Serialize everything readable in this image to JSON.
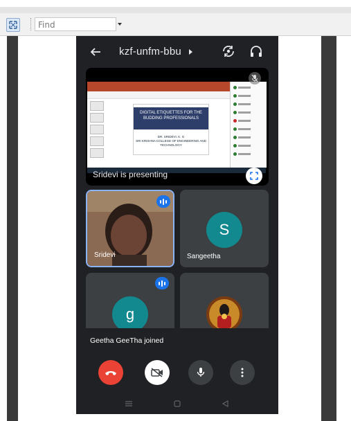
{
  "toolbar": {
    "find_placeholder": "Find",
    "expand_icon": "expand-icon"
  },
  "meeting": {
    "code": "kzf-unfm-bbu",
    "icons": {
      "back": "arrow-left-icon",
      "switch_camera": "camera-switch-icon",
      "audio": "headphones-icon"
    }
  },
  "presentation": {
    "label": "Sridevi is presenting",
    "slide_title": "DIGITAL ETIQUETTES FOR THE BUDDING PROFESSIONALS",
    "slide_author": "DR. SRIDEVI. K. G",
    "slide_college": "SRI KRISHNA COLLEGE OF ENGINEERING AND TECHNOLOGY"
  },
  "participants": [
    {
      "name": "Sridevi",
      "speaking": true,
      "type": "photo"
    },
    {
      "name": "Sangeetha",
      "speaking": false,
      "type": "letter",
      "initial": "S",
      "color": "#12888f"
    },
    {
      "name": "",
      "speaking": true,
      "type": "letter",
      "initial": "g",
      "color": "#12888f"
    },
    {
      "name": "",
      "speaking": false,
      "type": "image"
    }
  ],
  "notification": "Geetha GeeTha joined",
  "controls": {
    "end_call": {
      "icon": "phone-hangup-icon",
      "color": "#ea4335"
    },
    "camera": {
      "icon": "camera-off-icon",
      "color": "#ffffff"
    },
    "mic": {
      "icon": "microphone-icon",
      "color": "#3c4043"
    },
    "more": {
      "icon": "more-vert-icon",
      "color": "#3c4043"
    }
  }
}
